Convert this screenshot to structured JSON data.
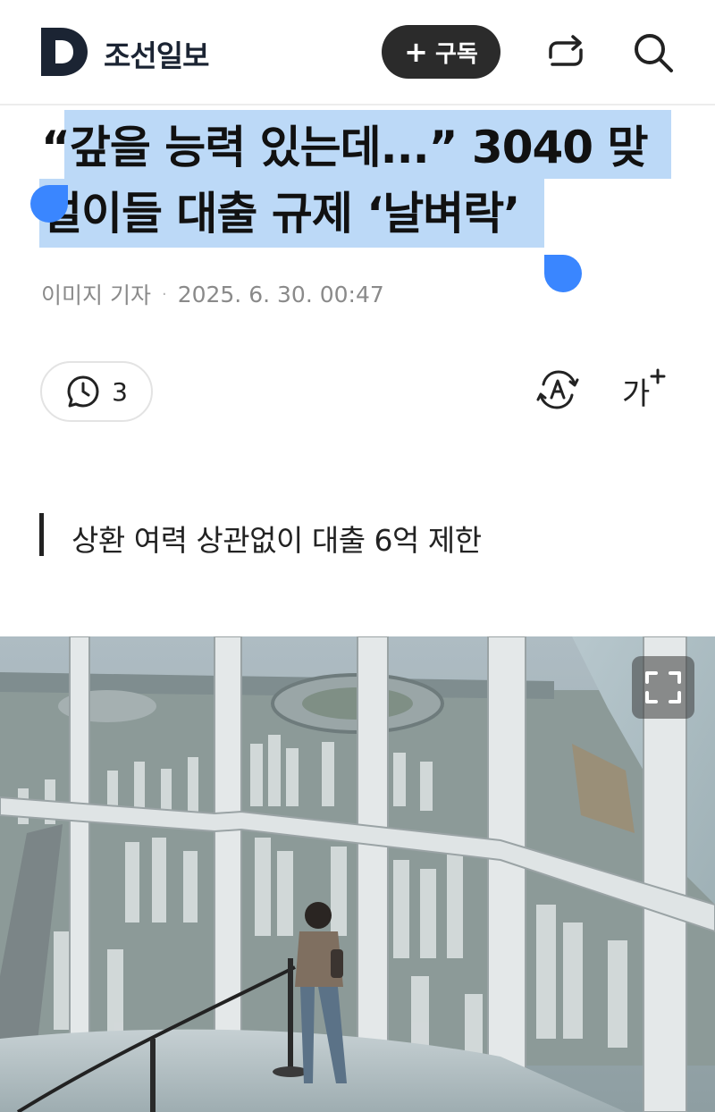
{
  "header": {
    "logo_letter": "D",
    "brand": "조선일보",
    "subscribe_plus": "+",
    "subscribe_label": "구독",
    "share_icon": "share-arrows-icon",
    "search_icon": "search-icon"
  },
  "article": {
    "headline_line1": "“갚을 능력 있는데...” 3040 맞",
    "headline_line2": "벌이들 대출 규제 ‘날벼락’",
    "author": "이미지 기자",
    "separator": "·",
    "timestamp": "2025. 6. 30. 00:47",
    "comment_count": "3",
    "font_size_label": "가",
    "subheadline": "상환 여력 상관없이 대출 6억 제한"
  },
  "colors": {
    "selection": "#bcd9f7",
    "selection_handle": "#3a86ff",
    "brand_navy": "#1b2433",
    "button_dark": "#2b2b2b"
  }
}
